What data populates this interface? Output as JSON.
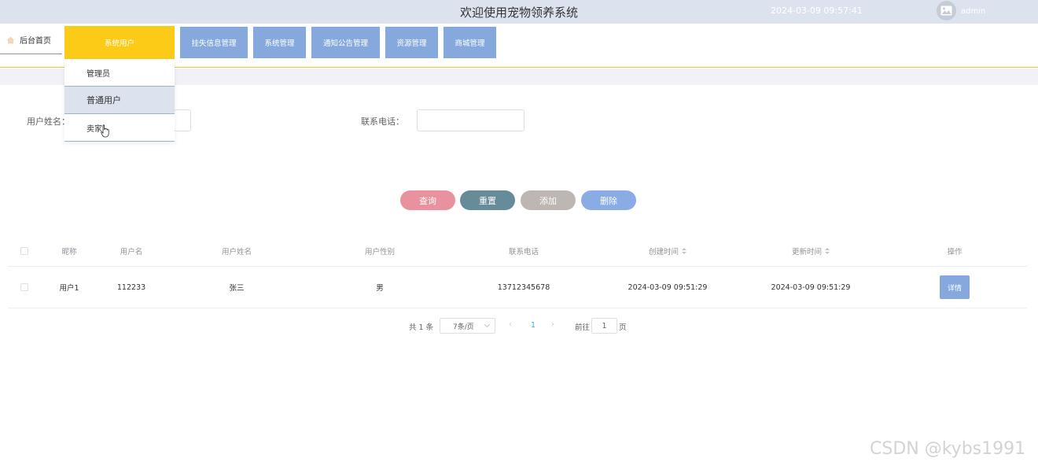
{
  "header": {
    "title": "欢迎使用宠物领养系统",
    "datetime": "2024-03-09 09:57:41",
    "username": "admin"
  },
  "nav": {
    "home": "后台首页",
    "items": [
      "系统用户",
      "挂失信息管理",
      "系统管理",
      "通知公告管理",
      "资源管理",
      "商城管理"
    ],
    "active": "系统用户",
    "dropdown": [
      "管理员",
      "普通用户",
      "卖家"
    ]
  },
  "search": {
    "name_label": "用户姓名：",
    "phone_label": "联系电话："
  },
  "buttons": {
    "query": "查询",
    "reset": "重置",
    "add": "添加",
    "delete": "删除"
  },
  "colors": {
    "query": "#e9919f",
    "reset": "#678c99",
    "add": "#bdb6b2",
    "delete": "#88ace3",
    "nav": "#85a9dd",
    "nav_active": "#fccb18"
  },
  "table": {
    "columns": [
      "昵称",
      "用户名",
      "用户姓名",
      "用户性别",
      "联系电话",
      "创建时间",
      "更新时间",
      "操作"
    ],
    "rows": [
      {
        "nickname": "用户1",
        "username": "112233",
        "realname": "张三",
        "gender": "男",
        "phone": "13712345678",
        "created": "2024-03-09 09:51:29",
        "updated": "2024-03-09 09:51:29",
        "action": "详情"
      }
    ]
  },
  "pagination": {
    "total": "共 1 条",
    "page_size": "7条/页",
    "current": "1",
    "goto_label": "前往",
    "goto_value": "1",
    "page_suffix": "页"
  },
  "watermark": "CSDN @kybs1991"
}
